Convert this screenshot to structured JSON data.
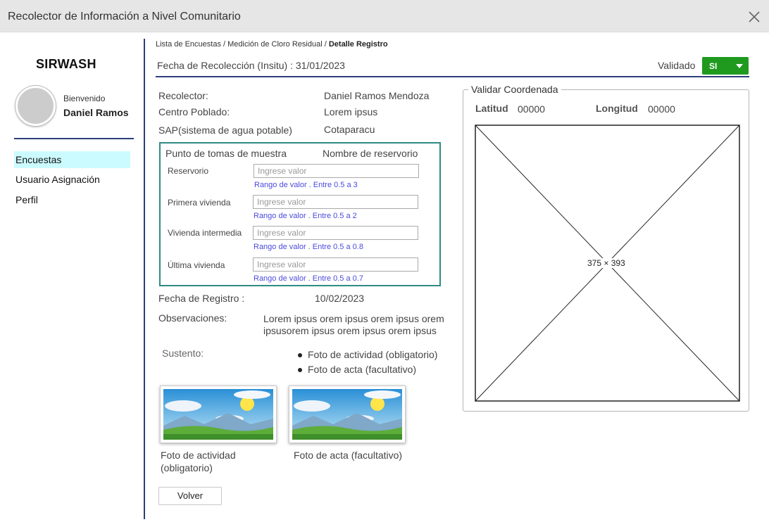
{
  "window": {
    "title": "Recolector de Información a Nivel Comunitario"
  },
  "sidebar": {
    "brand": "SIRWASH",
    "welcome": "Bienvenido",
    "user_name": "Daniel Ramos",
    "items": [
      {
        "label": "Encuestas",
        "active": true
      },
      {
        "label": "Usuario Asignación",
        "active": false
      },
      {
        "label": "Perfil",
        "active": false
      }
    ]
  },
  "breadcrumb": {
    "item1": "Lista de Encuestas",
    "sep": "/",
    "item2": "Medición de Cloro Residual",
    "current": "Detalle Registro"
  },
  "header": {
    "fecha_label": "Fecha de Recolección (Insitu) : 31/01/2023",
    "validado_label": "Validado",
    "validado_value": "SI"
  },
  "info": {
    "recolector_label": "Recolector:",
    "recolector_value": "Daniel Ramos Mendoza",
    "centro_label": "Centro Poblado:",
    "centro_value": "Lorem ipsus",
    "sap_label": "SAP(sistema de agua potable)",
    "sap_value": "Cotaparacu"
  },
  "sampling": {
    "title": "Punto de tomas de muestra",
    "reservoir_header": "Nombre de reservorio",
    "placeholder": "Ingrese valor",
    "fields": [
      {
        "label": "Reservorio",
        "hint": "Rango de valor . Entre 0.5 a 3"
      },
      {
        "label": "Primera vivienda",
        "hint": "Rango de valor . Entre 0.5 a 2"
      },
      {
        "label": "Vivienda intermedia",
        "hint": "Rango de valor . Entre 0.5 a 0.8"
      },
      {
        "label": "Última vivienda",
        "hint": "Rango de valor . Entre 0.5 a 0.7"
      }
    ]
  },
  "registro": {
    "label": "Fecha de Registro :",
    "value": "10/02/2023"
  },
  "observaciones": {
    "label": "Observaciones:",
    "line1": "Lorem ipsus orem ipsus orem ipsus orem",
    "line2": "ipsusorem ipsus orem ipsus orem ipsus"
  },
  "sustento": {
    "label": "Sustento:",
    "items": [
      "Foto de actividad (obligatorio)",
      "Foto de acta (facultativo)"
    ]
  },
  "photos": [
    {
      "caption_line1": "Foto de actividad",
      "caption_line2": "(obligatorio)"
    },
    {
      "caption_line1": "Foto de acta (facultativo)"
    }
  ],
  "buttons": {
    "volver": "Volver"
  },
  "coordinates": {
    "legend": "Validar Coordenada",
    "lat_label": "Latitud",
    "lat_value": "00000",
    "lon_label": "Longitud",
    "lon_value": "00000",
    "map_placeholder": "375 × 393"
  },
  "colors": {
    "accent_navy": "#2c3e7a",
    "active_menu": "#ccfbff",
    "validado_green": "#1f9a1f",
    "sample_border": "#2e8b82",
    "hint_blue": "#4a4adf"
  }
}
